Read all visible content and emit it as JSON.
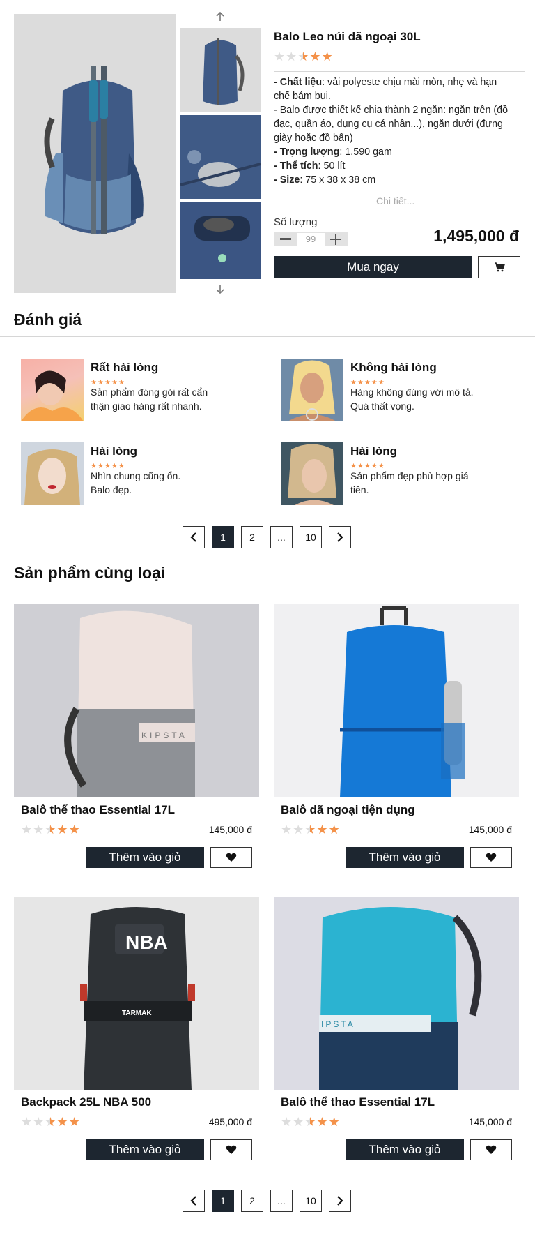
{
  "product": {
    "title": "Balo Leo núi dã ngoại 30L",
    "desc_lines": [
      {
        "label": "- Chất liệu",
        "text": ": vải polyeste chịu mài mòn, nhẹ và hạn"
      },
      {
        "label": "",
        "text": "chế bám bụi."
      },
      {
        "label": "",
        "text": "- Balo được thiết kế chia thành 2 ngăn: ngăn trên (đồ"
      },
      {
        "label": "",
        "text": "đạc, quần áo, dụng cụ cá nhân...), ngăn dưới (đựng"
      },
      {
        "label": "",
        "text": "giày hoặc đồ bẩn)"
      },
      {
        "label": "- Trọng lượng",
        "text": ": 1.590 gam"
      },
      {
        "label": "- Thể tích",
        "text": ": 50 lít"
      },
      {
        "label": "- Size",
        "text": ": 75 x 38 x 38 cm"
      }
    ],
    "details_link": "Chi tiết...",
    "quantity_label": "Số lượng",
    "quantity_value": "99",
    "price": "1,495,000 đ",
    "buy_label": "Mua ngay",
    "rating": 2.5
  },
  "reviews": {
    "heading": "Đánh giá",
    "items": [
      {
        "title": "Rất hài lòng",
        "line1": "Sản phẩm đóng gói rất cẩn",
        "line2": "thận giao hàng rất nhanh."
      },
      {
        "title": "Không hài lòng",
        "line1": "Hàng không đúng với mô tả.",
        "line2": "Quá thất vọng."
      },
      {
        "title": "Hài lòng",
        "line1": "Nhìn chung cũng ổn.",
        "line2": "Balo đẹp."
      },
      {
        "title": "Hài lòng",
        "line1": "Sản phẩm đẹp phù hợp giá",
        "line2": "tiền."
      }
    ]
  },
  "pagination": {
    "p1": "1",
    "p2": "2",
    "ellipsis": "...",
    "last": "10"
  },
  "related": {
    "heading": "Sản phẩm cùng loại",
    "add_label": "Thêm vào giỏ",
    "items": [
      {
        "name": "Balô thể thao Essential 17L",
        "price": "145,000 đ",
        "rating": 2.5
      },
      {
        "name": "Balô dã ngoại tiện dụng",
        "price": "145,000 đ",
        "rating": 2.5
      },
      {
        "name": "Backpack 25L NBA 500",
        "price": "495,000 đ",
        "rating": 2.5
      },
      {
        "name": "Balô thể thao Essential 17L",
        "price": "145,000 đ",
        "rating": 2.5
      }
    ],
    "image_texts": {
      "kipsta": "KIPSTA",
      "nba": "NBA",
      "tarmak": "TARMAK",
      "ipsta": "IPSTA"
    }
  },
  "colors": {
    "dark": "#1d2630",
    "star": "#f4924a",
    "star_off": "#dddddd",
    "placeholder": "#d9d9d9"
  },
  "icons": [
    "arrow-up-icon",
    "arrow-down-icon",
    "minus-icon",
    "plus-icon",
    "cart-icon",
    "heart-icon",
    "chevron-left-icon",
    "chevron-right-icon",
    "star-icon"
  ]
}
